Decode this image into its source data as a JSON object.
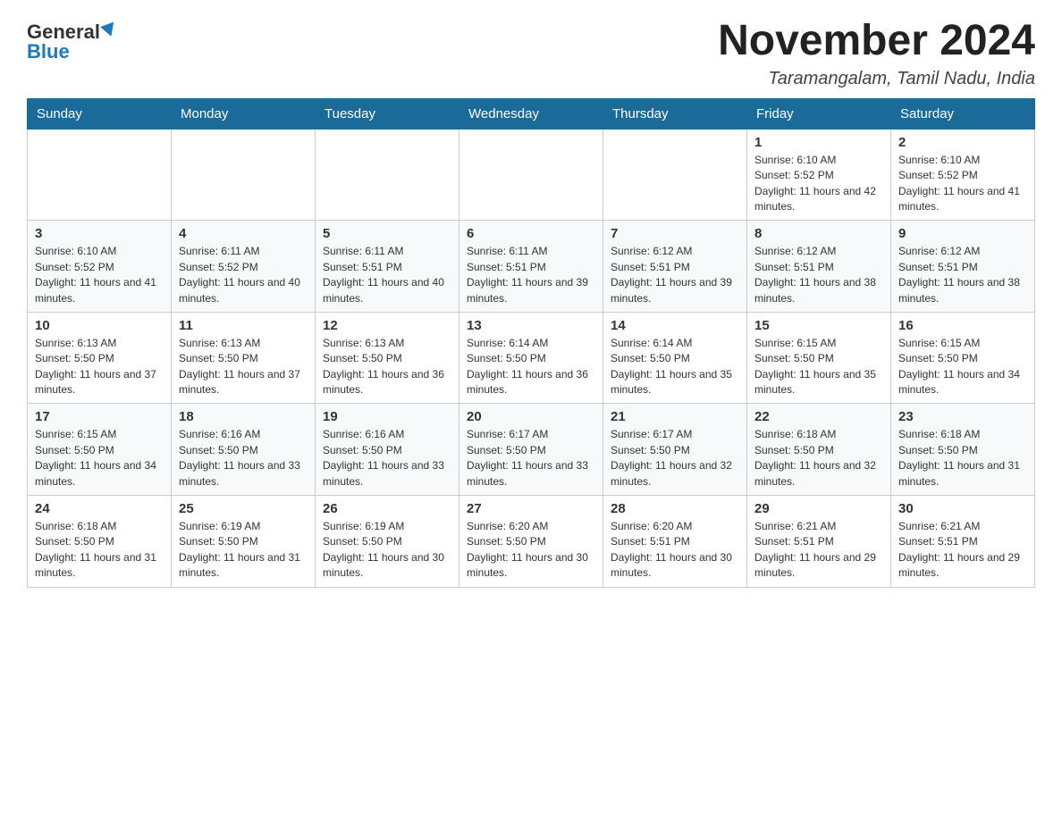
{
  "header": {
    "logo_general": "General",
    "logo_blue": "Blue",
    "month_title": "November 2024",
    "location": "Taramangalam, Tamil Nadu, India"
  },
  "weekdays": [
    "Sunday",
    "Monday",
    "Tuesday",
    "Wednesday",
    "Thursday",
    "Friday",
    "Saturday"
  ],
  "weeks": [
    [
      {
        "day": "",
        "sunrise": "",
        "sunset": "",
        "daylight": ""
      },
      {
        "day": "",
        "sunrise": "",
        "sunset": "",
        "daylight": ""
      },
      {
        "day": "",
        "sunrise": "",
        "sunset": "",
        "daylight": ""
      },
      {
        "day": "",
        "sunrise": "",
        "sunset": "",
        "daylight": ""
      },
      {
        "day": "",
        "sunrise": "",
        "sunset": "",
        "daylight": ""
      },
      {
        "day": "1",
        "sunrise": "Sunrise: 6:10 AM",
        "sunset": "Sunset: 5:52 PM",
        "daylight": "Daylight: 11 hours and 42 minutes."
      },
      {
        "day": "2",
        "sunrise": "Sunrise: 6:10 AM",
        "sunset": "Sunset: 5:52 PM",
        "daylight": "Daylight: 11 hours and 41 minutes."
      }
    ],
    [
      {
        "day": "3",
        "sunrise": "Sunrise: 6:10 AM",
        "sunset": "Sunset: 5:52 PM",
        "daylight": "Daylight: 11 hours and 41 minutes."
      },
      {
        "day": "4",
        "sunrise": "Sunrise: 6:11 AM",
        "sunset": "Sunset: 5:52 PM",
        "daylight": "Daylight: 11 hours and 40 minutes."
      },
      {
        "day": "5",
        "sunrise": "Sunrise: 6:11 AM",
        "sunset": "Sunset: 5:51 PM",
        "daylight": "Daylight: 11 hours and 40 minutes."
      },
      {
        "day": "6",
        "sunrise": "Sunrise: 6:11 AM",
        "sunset": "Sunset: 5:51 PM",
        "daylight": "Daylight: 11 hours and 39 minutes."
      },
      {
        "day": "7",
        "sunrise": "Sunrise: 6:12 AM",
        "sunset": "Sunset: 5:51 PM",
        "daylight": "Daylight: 11 hours and 39 minutes."
      },
      {
        "day": "8",
        "sunrise": "Sunrise: 6:12 AM",
        "sunset": "Sunset: 5:51 PM",
        "daylight": "Daylight: 11 hours and 38 minutes."
      },
      {
        "day": "9",
        "sunrise": "Sunrise: 6:12 AM",
        "sunset": "Sunset: 5:51 PM",
        "daylight": "Daylight: 11 hours and 38 minutes."
      }
    ],
    [
      {
        "day": "10",
        "sunrise": "Sunrise: 6:13 AM",
        "sunset": "Sunset: 5:50 PM",
        "daylight": "Daylight: 11 hours and 37 minutes."
      },
      {
        "day": "11",
        "sunrise": "Sunrise: 6:13 AM",
        "sunset": "Sunset: 5:50 PM",
        "daylight": "Daylight: 11 hours and 37 minutes."
      },
      {
        "day": "12",
        "sunrise": "Sunrise: 6:13 AM",
        "sunset": "Sunset: 5:50 PM",
        "daylight": "Daylight: 11 hours and 36 minutes."
      },
      {
        "day": "13",
        "sunrise": "Sunrise: 6:14 AM",
        "sunset": "Sunset: 5:50 PM",
        "daylight": "Daylight: 11 hours and 36 minutes."
      },
      {
        "day": "14",
        "sunrise": "Sunrise: 6:14 AM",
        "sunset": "Sunset: 5:50 PM",
        "daylight": "Daylight: 11 hours and 35 minutes."
      },
      {
        "day": "15",
        "sunrise": "Sunrise: 6:15 AM",
        "sunset": "Sunset: 5:50 PM",
        "daylight": "Daylight: 11 hours and 35 minutes."
      },
      {
        "day": "16",
        "sunrise": "Sunrise: 6:15 AM",
        "sunset": "Sunset: 5:50 PM",
        "daylight": "Daylight: 11 hours and 34 minutes."
      }
    ],
    [
      {
        "day": "17",
        "sunrise": "Sunrise: 6:15 AM",
        "sunset": "Sunset: 5:50 PM",
        "daylight": "Daylight: 11 hours and 34 minutes."
      },
      {
        "day": "18",
        "sunrise": "Sunrise: 6:16 AM",
        "sunset": "Sunset: 5:50 PM",
        "daylight": "Daylight: 11 hours and 33 minutes."
      },
      {
        "day": "19",
        "sunrise": "Sunrise: 6:16 AM",
        "sunset": "Sunset: 5:50 PM",
        "daylight": "Daylight: 11 hours and 33 minutes."
      },
      {
        "day": "20",
        "sunrise": "Sunrise: 6:17 AM",
        "sunset": "Sunset: 5:50 PM",
        "daylight": "Daylight: 11 hours and 33 minutes."
      },
      {
        "day": "21",
        "sunrise": "Sunrise: 6:17 AM",
        "sunset": "Sunset: 5:50 PM",
        "daylight": "Daylight: 11 hours and 32 minutes."
      },
      {
        "day": "22",
        "sunrise": "Sunrise: 6:18 AM",
        "sunset": "Sunset: 5:50 PM",
        "daylight": "Daylight: 11 hours and 32 minutes."
      },
      {
        "day": "23",
        "sunrise": "Sunrise: 6:18 AM",
        "sunset": "Sunset: 5:50 PM",
        "daylight": "Daylight: 11 hours and 31 minutes."
      }
    ],
    [
      {
        "day": "24",
        "sunrise": "Sunrise: 6:18 AM",
        "sunset": "Sunset: 5:50 PM",
        "daylight": "Daylight: 11 hours and 31 minutes."
      },
      {
        "day": "25",
        "sunrise": "Sunrise: 6:19 AM",
        "sunset": "Sunset: 5:50 PM",
        "daylight": "Daylight: 11 hours and 31 minutes."
      },
      {
        "day": "26",
        "sunrise": "Sunrise: 6:19 AM",
        "sunset": "Sunset: 5:50 PM",
        "daylight": "Daylight: 11 hours and 30 minutes."
      },
      {
        "day": "27",
        "sunrise": "Sunrise: 6:20 AM",
        "sunset": "Sunset: 5:50 PM",
        "daylight": "Daylight: 11 hours and 30 minutes."
      },
      {
        "day": "28",
        "sunrise": "Sunrise: 6:20 AM",
        "sunset": "Sunset: 5:51 PM",
        "daylight": "Daylight: 11 hours and 30 minutes."
      },
      {
        "day": "29",
        "sunrise": "Sunrise: 6:21 AM",
        "sunset": "Sunset: 5:51 PM",
        "daylight": "Daylight: 11 hours and 29 minutes."
      },
      {
        "day": "30",
        "sunrise": "Sunrise: 6:21 AM",
        "sunset": "Sunset: 5:51 PM",
        "daylight": "Daylight: 11 hours and 29 minutes."
      }
    ]
  ]
}
